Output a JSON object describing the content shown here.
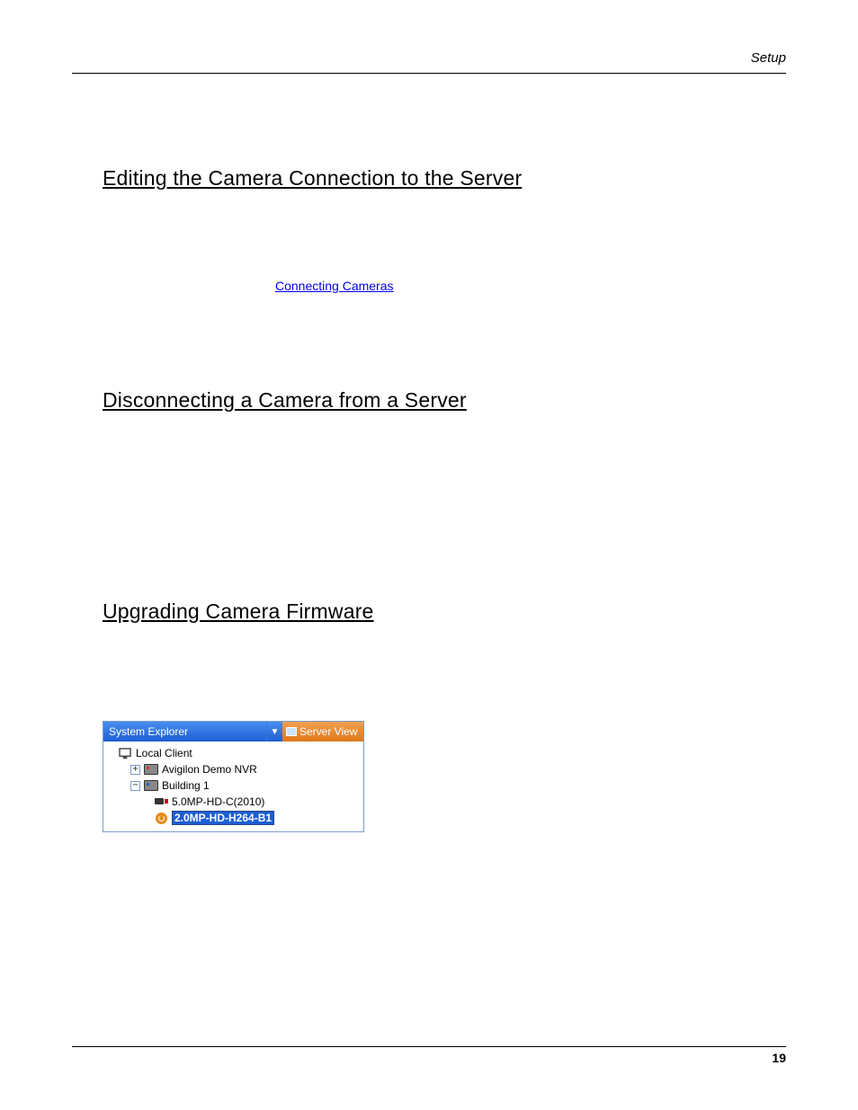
{
  "header": {
    "section": "Setup"
  },
  "sections": {
    "editing_title": "Editing the Camera Connection to the Server",
    "disconnecting_title": "Disconnecting a Camera from a Server",
    "upgrading_title": "Upgrading Camera Firmware"
  },
  "link": {
    "text": "Connecting Cameras"
  },
  "explorer": {
    "title": "System Explorer",
    "view_label": "Server View",
    "tree": {
      "root": "Local Client",
      "nodes": [
        {
          "expanded": false,
          "label": "Avigilon Demo NVR"
        },
        {
          "expanded": true,
          "label": "Building 1",
          "children": [
            {
              "label": "5.0MP-HD-C(2010)",
              "icon": "camera",
              "selected": false
            },
            {
              "label": "2.0MP-HD-H264-B1",
              "icon": "update",
              "selected": true
            }
          ]
        }
      ]
    }
  },
  "footer": {
    "page": "19"
  }
}
